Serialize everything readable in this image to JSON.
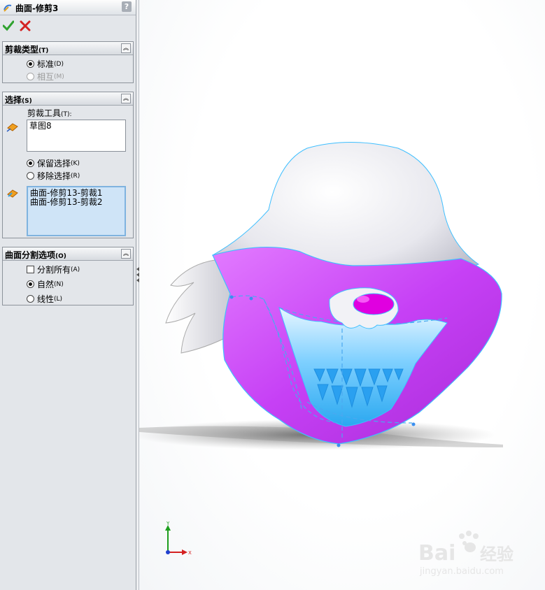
{
  "title": "曲面-修剪3",
  "help_label": "?",
  "trim_type": {
    "header": "剪裁类型",
    "header_key": "(T)",
    "options": [
      {
        "label": "标准",
        "key": "(D)",
        "selected": true,
        "enabled": true
      },
      {
        "label": "相互",
        "key": "(M)",
        "selected": false,
        "enabled": false
      }
    ]
  },
  "selection": {
    "header": "选择",
    "header_key": "(S)",
    "trim_tool_label": "剪裁工具",
    "trim_tool_key": "(T):",
    "trim_tool_value": "草图8",
    "options": [
      {
        "label": "保留选择",
        "key": "(K)",
        "selected": true
      },
      {
        "label": "移除选择",
        "key": "(R)",
        "selected": false
      }
    ],
    "pieces": [
      "曲面-修剪13-剪裁1",
      "曲面-修剪13-剪裁2"
    ]
  },
  "split_options": {
    "header": "曲面分割选项",
    "header_key": "(O)",
    "split_all": {
      "label": "分割所有",
      "key": "(A)",
      "checked": false
    },
    "options": [
      {
        "label": "自然",
        "key": "(N)",
        "selected": true
      },
      {
        "label": "线性",
        "key": "(L)",
        "selected": false
      }
    ]
  },
  "triad": {
    "y": "Y",
    "x": "X"
  },
  "watermark": {
    "brand": "Bai",
    "brand2": "经验",
    "url": "jingyan.baidu.com"
  },
  "colors": {
    "accent_magenta": "#c640f5",
    "accent_cyan": "#3fbfff",
    "panel_bg": "#e3e6ea"
  }
}
